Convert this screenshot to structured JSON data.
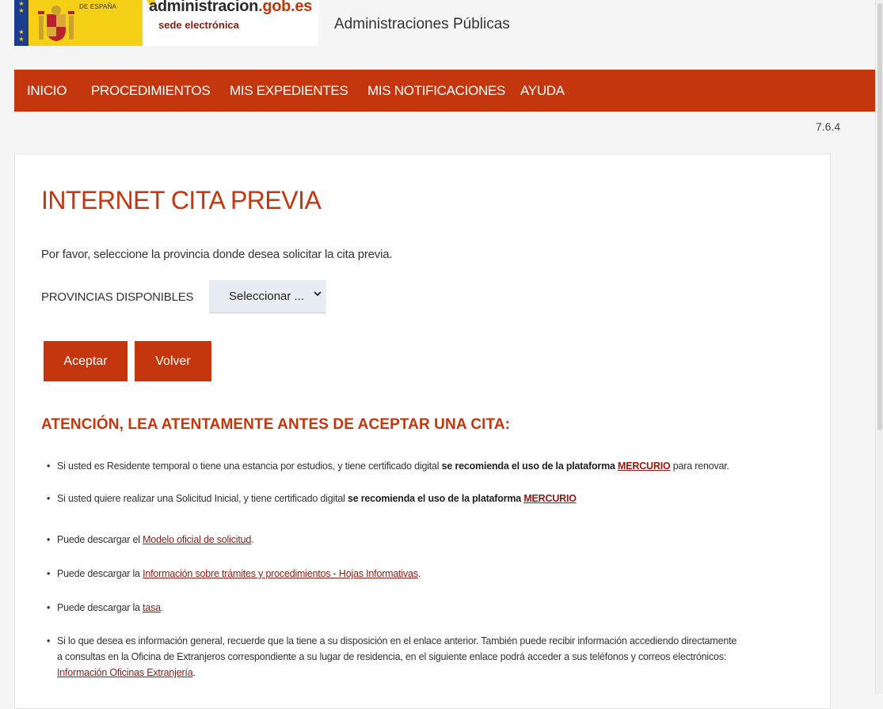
{
  "header": {
    "gov_logo_text": [
      "DE ESPAÑA"
    ],
    "admin_logo_name": "administracion",
    "admin_logo_domain": ".gob.es",
    "admin_logo_sub": "sede electrónica",
    "site_title": "Administraciones Públicas"
  },
  "nav": {
    "items": [
      {
        "label": "INICIO"
      },
      {
        "label": "PROCEDIMIENTOS"
      },
      {
        "label": "MIS EXPEDIENTES"
      },
      {
        "label": "MIS NOTIFICACIONES"
      },
      {
        "label": "AYUDA"
      }
    ]
  },
  "version": "7.6.4",
  "main": {
    "title": "INTERNET CITA PREVIA",
    "intro": "Por favor, seleccione la provincia donde desea solicitar la cita previa.",
    "province_label": "PROVINCIAS DISPONIBLES",
    "province_select_value": "Seleccionar ...",
    "accept_label": "Aceptar",
    "back_label": "Volver"
  },
  "notice": {
    "title": "ATENCIÓN, LEA ATENTAMENTE ANTES DE ACEPTAR UNA CITA:",
    "bullet1": {
      "pre": "Si usted es Residente temporal o tiene una estancia por estudios, y tiene certificado digital ",
      "bold": "se recomienda el uso de la plataforma ",
      "link": "MERCURIO",
      "post": " para renovar."
    },
    "bullet2": {
      "pre": "Si usted quiere realizar una Solicitud Inicial, y tiene certificado digital ",
      "bold": "se recomienda el uso de la plataforma ",
      "link": "MERCURIO"
    },
    "bullet3": {
      "pre": "Puede descargar el ",
      "link": "Modelo oficial de solicitud",
      "post": "."
    },
    "bullet4": {
      "pre": "Puede descargar la ",
      "link": "Información sobre trámites y procedimientos - Hojas Informativas",
      "post": "."
    },
    "bullet5": {
      "pre": "Puede descargar la ",
      "link": "tasa",
      "post": "."
    },
    "bullet6": {
      "line1": "Si lo que desea es información general, recuerde que la tiene a su disposición en el enlace anterior. También puede recibir información accediendo directamente",
      "line2": "a consultas en la Oficina de Extranjeros correspondiente a su lugar de residencia, en el siguiente enlace podrá acceder a sus teléfonos y correos electrónicos:",
      "link": "Información Oficinas Extranjería",
      "post": "."
    }
  },
  "colors": {
    "brand_red": "#c4360e",
    "link_red": "#8d1b12",
    "gov_yellow": "#f6cf17",
    "eu_blue": "#1b3d8f"
  },
  "icons": {
    "select_caret": "chevron-down-icon",
    "list_bullet": "•",
    "eu_star": "★"
  }
}
